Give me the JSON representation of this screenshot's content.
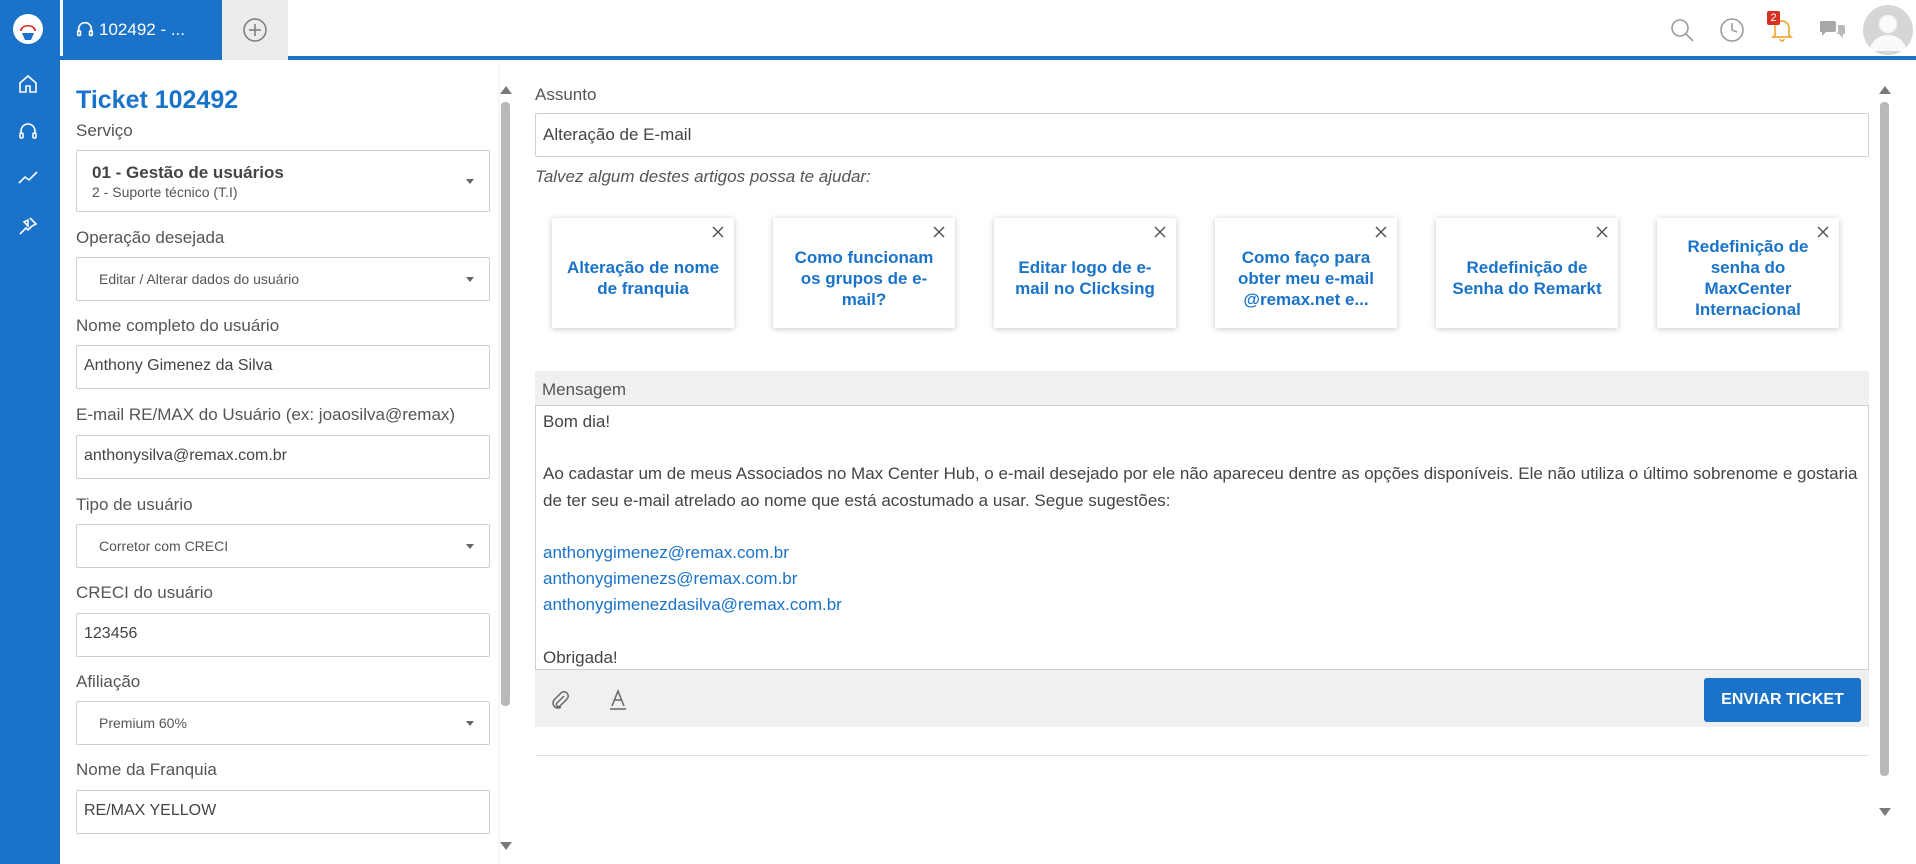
{
  "topbar": {
    "tab_title": "102492 - ...",
    "notification_count": "2"
  },
  "form": {
    "ticket_title": "Ticket 102492",
    "service_label": "Serviço",
    "service_main": "01 - Gestão de usuários",
    "service_sub": "2 - Suporte técnico (T.I)",
    "operation_label": "Operação desejada",
    "operation_value": "Editar / Alterar dados do usuário",
    "fullname_label": "Nome completo do usuário",
    "fullname_value": "Anthony Gimenez da Silva",
    "email_label": "E-mail RE/MAX do Usuário (ex: joaosilva@remax)",
    "email_value": "anthonysilva@remax.com.br",
    "usertype_label": "Tipo de usuário",
    "usertype_value": "Corretor com CRECI",
    "creci_label": "CRECI do usuário",
    "creci_value": "123456",
    "affiliation_label": "Afiliação",
    "affiliation_value": "Premium 60%",
    "franchise_label": "Nome da Franquia",
    "franchise_value": "RE/MAX YELLOW"
  },
  "main": {
    "subject_label": "Assunto",
    "subject_value": "Alteração de E-mail",
    "help_text": "Talvez algum destes artigos possa te ajudar:",
    "articles": [
      {
        "title": "Alteração de nome de franquia"
      },
      {
        "title": "Como funcionam os grupos de e-mail?"
      },
      {
        "title": "Editar logo de e-mail no Clicksing"
      },
      {
        "title": "Como faço para obter meu e-mail @remax.net e..."
      },
      {
        "title": "Redefinição de Senha do Remarkt"
      },
      {
        "title": "Redefinição de senha do MaxCenter Internacional"
      }
    ],
    "message_label": "Mensagem",
    "message": {
      "greeting": "Bom dia!",
      "body": "Ao cadastar um de meus Associados no Max Center Hub, o e-mail desejado por ele não apareceu dentre as opções disponíveis. Ele não utiliza o último sobrenome e gostaria de ter seu e-mail atrelado ao nome que está acostumado a usar. Segue sugestões:",
      "email1": "anthonygimenez@remax.com.br",
      "email2": "anthonygimenezs@remax.com.br",
      "email3": "anthonygimenezdasilva@remax.com.br",
      "closing": "Obrigada!"
    },
    "send_label": "ENVIAR TICKET"
  },
  "colors": {
    "brand": "#1a73c8",
    "badge": "#d93025"
  }
}
